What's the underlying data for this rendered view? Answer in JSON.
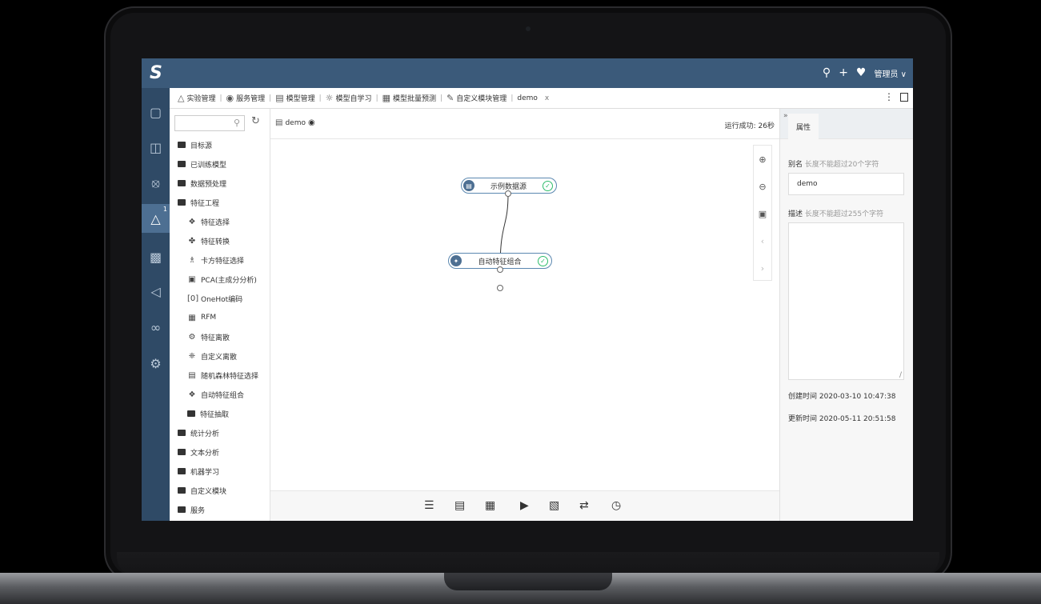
{
  "app": {
    "logo": "S"
  },
  "topbar": {
    "user": "管理员",
    "icons": [
      "search-icon",
      "plus-icon",
      "bell-icon"
    ],
    "caret": "∨"
  },
  "sidebar": {
    "icons": [
      "monitor-icon",
      "database-icon",
      "cube-icon",
      "experiment-icon",
      "chart-icon",
      "send-icon",
      "workflow-icon",
      "tools-icon"
    ],
    "badge": "1"
  },
  "tabs": [
    {
      "label": "实验管理",
      "icon": "flask-icon"
    },
    {
      "label": "服务管理",
      "icon": "service-icon"
    },
    {
      "label": "模型管理",
      "icon": "model-icon"
    },
    {
      "label": "模型自学习",
      "icon": "bulb-icon"
    },
    {
      "label": "模型批量预测",
      "icon": "chart-icon"
    },
    {
      "label": "自定义模块管理",
      "icon": "edit-icon"
    }
  ],
  "active_tab": {
    "label": "demo",
    "close": "x"
  },
  "tree": {
    "search_placeholder": "",
    "items": [
      {
        "label": "目标源",
        "level": 1,
        "icon": "folder-icon"
      },
      {
        "label": "已训练模型",
        "level": 1,
        "icon": "folder-icon"
      },
      {
        "label": "数据预处理",
        "level": 1,
        "icon": "folder-icon"
      },
      {
        "label": "特征工程",
        "level": 1,
        "icon": "folder-open-icon"
      },
      {
        "label": "特征选择",
        "level": 2,
        "icon": "feature-select-icon"
      },
      {
        "label": "特征转换",
        "level": 2,
        "icon": "feature-transform-icon"
      },
      {
        "label": "卡方特征选择",
        "level": 2,
        "icon": "chi-square-icon"
      },
      {
        "label": "PCA(主成分分析)",
        "level": 2,
        "icon": "pca-icon"
      },
      {
        "label": "OneHot编码",
        "level": 2,
        "icon": "onehot-icon"
      },
      {
        "label": "RFM",
        "level": 2,
        "icon": "rfm-icon"
      },
      {
        "label": "特征离散",
        "level": 2,
        "icon": "discrete-icon"
      },
      {
        "label": "自定义离散",
        "level": 2,
        "icon": "custom-discrete-icon"
      },
      {
        "label": "随机森林特征选择",
        "level": 2,
        "icon": "forest-icon"
      },
      {
        "label": "自动特征组合",
        "level": 2,
        "icon": "auto-combine-icon"
      },
      {
        "label": "特征抽取",
        "level": 2,
        "icon": "folder-icon"
      },
      {
        "label": "统计分析",
        "level": 1,
        "icon": "folder-icon"
      },
      {
        "label": "文本分析",
        "level": 1,
        "icon": "folder-icon"
      },
      {
        "label": "机器学习",
        "level": 1,
        "icon": "folder-icon"
      },
      {
        "label": "自定义模块",
        "level": 1,
        "icon": "folder-icon"
      },
      {
        "label": "服务",
        "level": 1,
        "icon": "folder-icon"
      }
    ]
  },
  "canvas": {
    "title": "demo",
    "status": "运行成功: 26秒",
    "nodes": [
      {
        "label": "示例数据源",
        "status": "success"
      },
      {
        "label": "自动特征组合",
        "status": "success"
      }
    ],
    "zoom_tools": [
      "zoom-in-icon",
      "zoom-out-icon",
      "fit-icon",
      "chevron-left-icon",
      "chevron-right-icon"
    ],
    "footer_tools": [
      "list-icon",
      "save-icon",
      "save-as-icon",
      "run-icon",
      "export-icon",
      "switch-icon",
      "schedule-icon"
    ]
  },
  "properties": {
    "tab": "属性",
    "alias_label": "别名",
    "alias_hint": "长度不能超过20个字符",
    "alias_value": "demo",
    "desc_label": "描述",
    "desc_hint": "长度不能超过255个字符",
    "desc_value": "",
    "created_label": "创建时间",
    "created_value": "2020-03-10 10:47:38",
    "updated_label": "更新时间",
    "updated_value": "2020-05-11 20:51:58"
  }
}
